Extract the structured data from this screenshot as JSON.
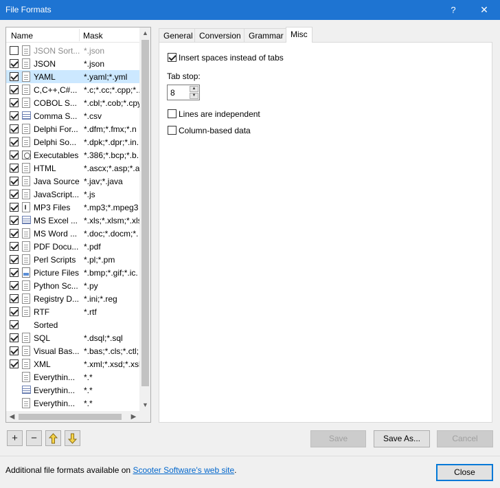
{
  "window": {
    "title": "File Formats",
    "help_glyph": "?",
    "close_glyph": "✕"
  },
  "list": {
    "col_name": "Name",
    "col_mask": "Mask",
    "items": [
      {
        "name": "JSON Sort...",
        "mask": "*.json",
        "checked": false,
        "disabled": true,
        "icon": "doc"
      },
      {
        "name": "JSON",
        "mask": "*.json",
        "checked": true,
        "icon": "doc"
      },
      {
        "name": "YAML",
        "mask": "*.yaml;*.yml",
        "checked": true,
        "selected": true,
        "icon": "doc"
      },
      {
        "name": "C,C++,C#...",
        "mask": "*.c;*.cc;*.cpp;*...",
        "checked": true,
        "icon": "doc"
      },
      {
        "name": "COBOL S...",
        "mask": "*.cbl;*.cob;*.cpy",
        "checked": true,
        "icon": "doc"
      },
      {
        "name": "Comma S...",
        "mask": "*.csv",
        "checked": true,
        "icon": "grid"
      },
      {
        "name": "Delphi For...",
        "mask": "*.dfm;*.fmx;*.n",
        "checked": true,
        "icon": "doc"
      },
      {
        "name": "Delphi So...",
        "mask": "*.dpk;*.dpr;*.in.",
        "checked": true,
        "icon": "doc"
      },
      {
        "name": "Executables",
        "mask": "*.386;*.bcp;*.b..",
        "checked": true,
        "icon": "gear"
      },
      {
        "name": "HTML",
        "mask": "*.ascx;*.asp;*.a..",
        "checked": true,
        "icon": "doc"
      },
      {
        "name": "Java Source",
        "mask": "*.jav;*.java",
        "checked": true,
        "icon": "doc"
      },
      {
        "name": "JavaScript...",
        "mask": "*.js",
        "checked": true,
        "icon": "doc"
      },
      {
        "name": "MP3 Files",
        "mask": "*.mp3;*.mpeg3",
        "checked": true,
        "icon": "music"
      },
      {
        "name": "MS Excel ...",
        "mask": "*.xls;*.xlsm;*.xls",
        "checked": true,
        "icon": "grid"
      },
      {
        "name": "MS Word ...",
        "mask": "*.doc;*.docm;*.",
        "checked": true,
        "icon": "doc"
      },
      {
        "name": "PDF Docu...",
        "mask": "*.pdf",
        "checked": true,
        "icon": "doc"
      },
      {
        "name": "Perl Scripts",
        "mask": "*.pl;*.pm",
        "checked": true,
        "icon": "doc"
      },
      {
        "name": "Picture Files",
        "mask": "*.bmp;*.gif;*.ic.",
        "checked": true,
        "icon": "picture"
      },
      {
        "name": "Python Sc...",
        "mask": "*.py",
        "checked": true,
        "icon": "doc"
      },
      {
        "name": "Registry D...",
        "mask": "*.ini;*.reg",
        "checked": true,
        "icon": "doc"
      },
      {
        "name": "RTF",
        "mask": "*.rtf",
        "checked": true,
        "icon": "doc"
      },
      {
        "name": "Sorted",
        "mask": "",
        "checked": true,
        "icon": "none"
      },
      {
        "name": "SQL",
        "mask": "*.dsql;*.sql",
        "checked": true,
        "icon": "doc"
      },
      {
        "name": "Visual Bas...",
        "mask": "*.bas;*.cls;*.ctl;.",
        "checked": true,
        "icon": "doc"
      },
      {
        "name": "XML",
        "mask": "*.xml;*.xsd;*.xsl",
        "checked": true,
        "icon": "doc"
      },
      {
        "name": "Everythin...",
        "mask": "*.*",
        "checked": null,
        "icon": "doc"
      },
      {
        "name": "Everythin...",
        "mask": "*.*",
        "checked": null,
        "icon": "grid"
      },
      {
        "name": "Everythin...",
        "mask": "*.*",
        "checked": null,
        "icon": "doc"
      }
    ]
  },
  "tabs": [
    {
      "label": "General",
      "active": false
    },
    {
      "label": "Conversion",
      "active": false
    },
    {
      "label": "Grammar",
      "active": false
    },
    {
      "label": "Misc",
      "active": true
    }
  ],
  "misc": {
    "insert_spaces": {
      "label": "Insert spaces instead of tabs",
      "checked": true
    },
    "tab_stop": {
      "label": "Tab stop:",
      "value": "8"
    },
    "lines_independent": {
      "label": "Lines are independent",
      "checked": false
    },
    "column_based": {
      "label": "Column-based data",
      "checked": false
    }
  },
  "toolbar": {
    "add_glyph": "+",
    "remove_glyph": "−"
  },
  "buttons": {
    "save": "Save",
    "save_as": "Save As...",
    "cancel": "Cancel",
    "close": "Close"
  },
  "footer": {
    "prefix": "Additional file formats available on ",
    "link": "Scooter Software's web site",
    "suffix": "."
  },
  "colors": {
    "titlebar": "#1e74d2",
    "selection": "#cce8ff",
    "link": "#0066cc",
    "default_button_border": "#0078d7"
  }
}
